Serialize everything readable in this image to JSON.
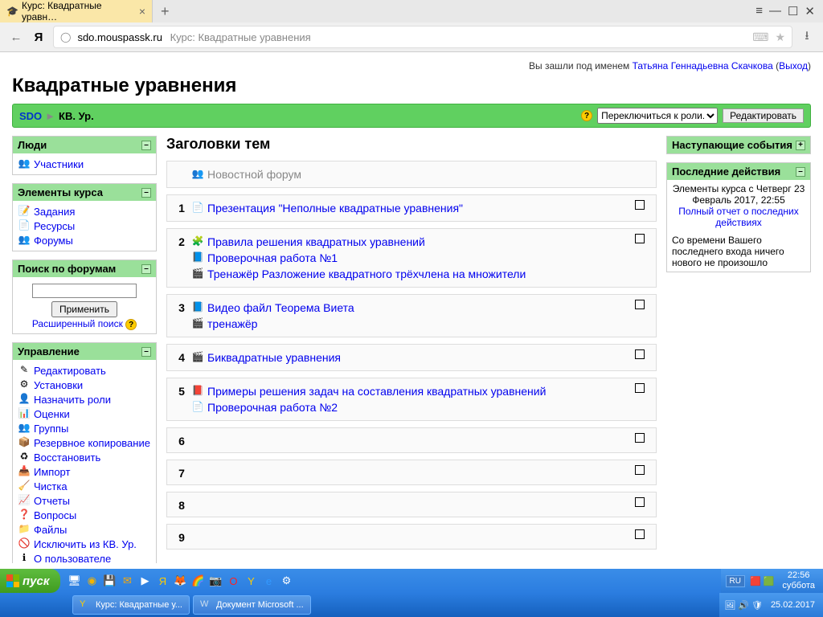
{
  "browser": {
    "tab_title": "Курс: Квадратные уравн…",
    "url_domain": "sdo.mouspassk.ru",
    "url_title": "Курс: Квадратные уравнения"
  },
  "login": {
    "prefix": "Вы зашли под именем ",
    "user": "Татьяна Геннадьевна Скачкова",
    "logout": "Выход"
  },
  "course_title": "Квадратные уравнения",
  "breadcrumb": {
    "root": "SDO",
    "current": "КВ. Ур."
  },
  "toolbar": {
    "role_switch": "Переключиться к роли...",
    "edit": "Редактировать"
  },
  "blocks": {
    "people": {
      "title": "Люди",
      "items": [
        "Участники"
      ]
    },
    "elements": {
      "title": "Элементы курса",
      "items": [
        "Задания",
        "Ресурсы",
        "Форумы"
      ]
    },
    "search": {
      "title": "Поиск по форумам",
      "button": "Применить",
      "advanced": "Расширенный поиск"
    },
    "admin": {
      "title": "Управление",
      "items": [
        "Редактировать",
        "Установки",
        "Назначить роли",
        "Оценки",
        "Группы",
        "Резервное копирование",
        "Восстановить",
        "Импорт",
        "Чистка",
        "Отчеты",
        "Вопросы",
        "Файлы",
        "Исключить из КВ. Ур.",
        "О пользователе"
      ]
    },
    "upcoming": {
      "title": "Наступающие события"
    },
    "recent": {
      "title": "Последние действия",
      "since": "Элементы курса с Четверг 23 Февраль 2017, 22:55",
      "full_report": "Полный отчет о последних действиях",
      "nothing": "Со времени Вашего последнего входа ничего нового не произошло"
    }
  },
  "topics_heading": "Заголовки тем",
  "topics": [
    {
      "num": "",
      "items": [
        {
          "label": "Новостной форум",
          "muted": true
        }
      ]
    },
    {
      "num": "1",
      "items": [
        {
          "label": "Презентация \"Неполные квадратные уравнения\""
        }
      ]
    },
    {
      "num": "2",
      "items": [
        {
          "label": "Правила решения квадратных уравнений"
        },
        {
          "label": "Проверочная работа №1"
        },
        {
          "label": "Тренажёр Разложение квадратного трёхчлена на множители"
        }
      ]
    },
    {
      "num": "3",
      "items": [
        {
          "label": "Видео файл Теорема Виета"
        },
        {
          "label": "тренажёр"
        }
      ]
    },
    {
      "num": "4",
      "items": [
        {
          "label": "Биквадратные уравнения"
        }
      ]
    },
    {
      "num": "5",
      "items": [
        {
          "label": "Примеры решения задач на составления квадратных уравнений"
        },
        {
          "label": "Проверочная работа №2"
        }
      ]
    },
    {
      "num": "6",
      "items": []
    },
    {
      "num": "7",
      "items": []
    },
    {
      "num": "8",
      "items": []
    },
    {
      "num": "9",
      "items": []
    }
  ],
  "taskbar": {
    "start": "пуск",
    "apps": [
      {
        "label": "Курс: Квадратные у..."
      },
      {
        "label": "Документ Microsoft ..."
      }
    ],
    "lang": "RU",
    "time": "22:56",
    "day": "суббота",
    "date": "25.02.2017"
  }
}
